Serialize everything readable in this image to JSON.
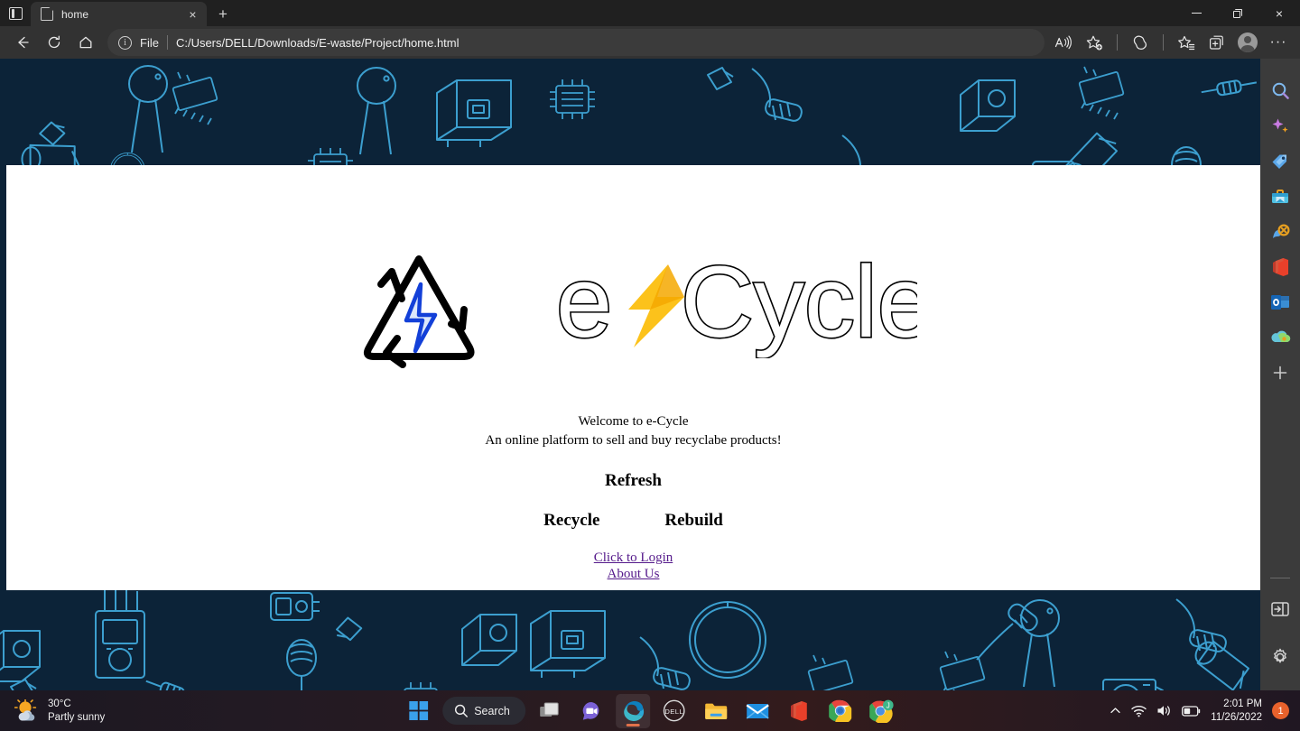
{
  "browser": {
    "tab_search_icon": "tab-search-icon",
    "tab": {
      "title": "home",
      "favicon": "page-icon",
      "close_label": "×"
    },
    "new_tab_label": "+",
    "window_controls": {
      "minimize": "minimize-icon",
      "maximize": "restore-icon",
      "close": "×"
    },
    "nav": {
      "back": "back-arrow-icon",
      "refresh": "refresh-icon",
      "home": "home-icon"
    },
    "address": {
      "info_glyph": "i",
      "scheme_label": "File",
      "url": "C:/Users/DELL/Downloads/E-waste/Project/home.html"
    },
    "toolbar_actions": [
      {
        "name": "read-aloud-icon",
        "label": "A"
      },
      {
        "name": "add-favorite-icon",
        "label": ""
      },
      {
        "name": "split-screen-icon",
        "label": ""
      },
      {
        "name": "favorites-icon",
        "label": ""
      },
      {
        "name": "collections-icon",
        "label": ""
      },
      {
        "name": "profile-avatar",
        "label": ""
      },
      {
        "name": "settings-more-icon",
        "label": "···"
      }
    ]
  },
  "sidebar": {
    "items": [
      {
        "name": "search-icon",
        "label": "Search"
      },
      {
        "name": "copilot-sparkle-icon",
        "label": "Discover"
      },
      {
        "name": "shopping-tag-icon",
        "label": "Shopping"
      },
      {
        "name": "tools-briefcase-icon",
        "label": "Tools"
      },
      {
        "name": "games-icon",
        "label": "Games"
      },
      {
        "name": "office-icon",
        "label": "Office"
      },
      {
        "name": "outlook-icon",
        "label": "Outlook"
      },
      {
        "name": "onedrive-icon",
        "label": "OneDrive"
      },
      {
        "name": "add-sidebar-app-icon",
        "label": "+"
      }
    ],
    "bottom": [
      {
        "name": "toggle-sidebar-icon",
        "label": "Toggle sidebar"
      },
      {
        "name": "sidebar-settings-gear-icon",
        "label": "Settings"
      }
    ]
  },
  "page": {
    "background": {
      "fill": "#0c2338",
      "stroke": "#3c9fcf",
      "theme": "electronics-doodle-pattern"
    },
    "logo": {
      "recycle_icon": "recycle-triangle-bolt-logo",
      "brand_name": "e-Cycle",
      "brand_part_1": "e",
      "brand_part_2": "Cycle",
      "bolt_icon": "yellow-lightning-bolt",
      "bolt_color": "#fcc21b",
      "outline_color": "#000000"
    },
    "welcome_line_1": "Welcome to e-Cycle",
    "welcome_line_2": "An online platform to sell and buy recyclabe products!",
    "refresh_label": "Refresh",
    "recycle_label": "Recycle",
    "rebuild_label": "Rebuild",
    "links": [
      {
        "label": "Click to Login",
        "name": "click-to-login-link"
      },
      {
        "label": "About Us",
        "name": "about-us-link"
      }
    ],
    "link_color": "#551a8b"
  },
  "taskbar": {
    "weather": {
      "temperature": "30°C",
      "condition": "Partly sunny",
      "icon": "partly-sunny-icon"
    },
    "start_label": "Start",
    "search_label": "Search",
    "apps": [
      {
        "name": "task-view-icon",
        "label": "Task View"
      },
      {
        "name": "chat-teams-icon",
        "label": "Chat"
      },
      {
        "name": "edge-icon",
        "label": "Microsoft Edge",
        "active": true
      },
      {
        "name": "dell-icon",
        "label": "DELL"
      },
      {
        "name": "file-explorer-icon",
        "label": "File Explorer"
      },
      {
        "name": "mail-icon",
        "label": "Mail"
      },
      {
        "name": "office-icon",
        "label": "Office"
      },
      {
        "name": "chrome-icon",
        "label": "Google Chrome"
      },
      {
        "name": "chrome-profile-icon",
        "label": "Chrome Profile J",
        "badge": "J"
      }
    ],
    "tray": {
      "chevron": "show-hidden-icons",
      "wifi": "wifi-icon",
      "volume": "volume-icon",
      "battery": "battery-icon",
      "time": "2:01 PM",
      "date": "11/26/2022",
      "notification_count": "1"
    }
  }
}
